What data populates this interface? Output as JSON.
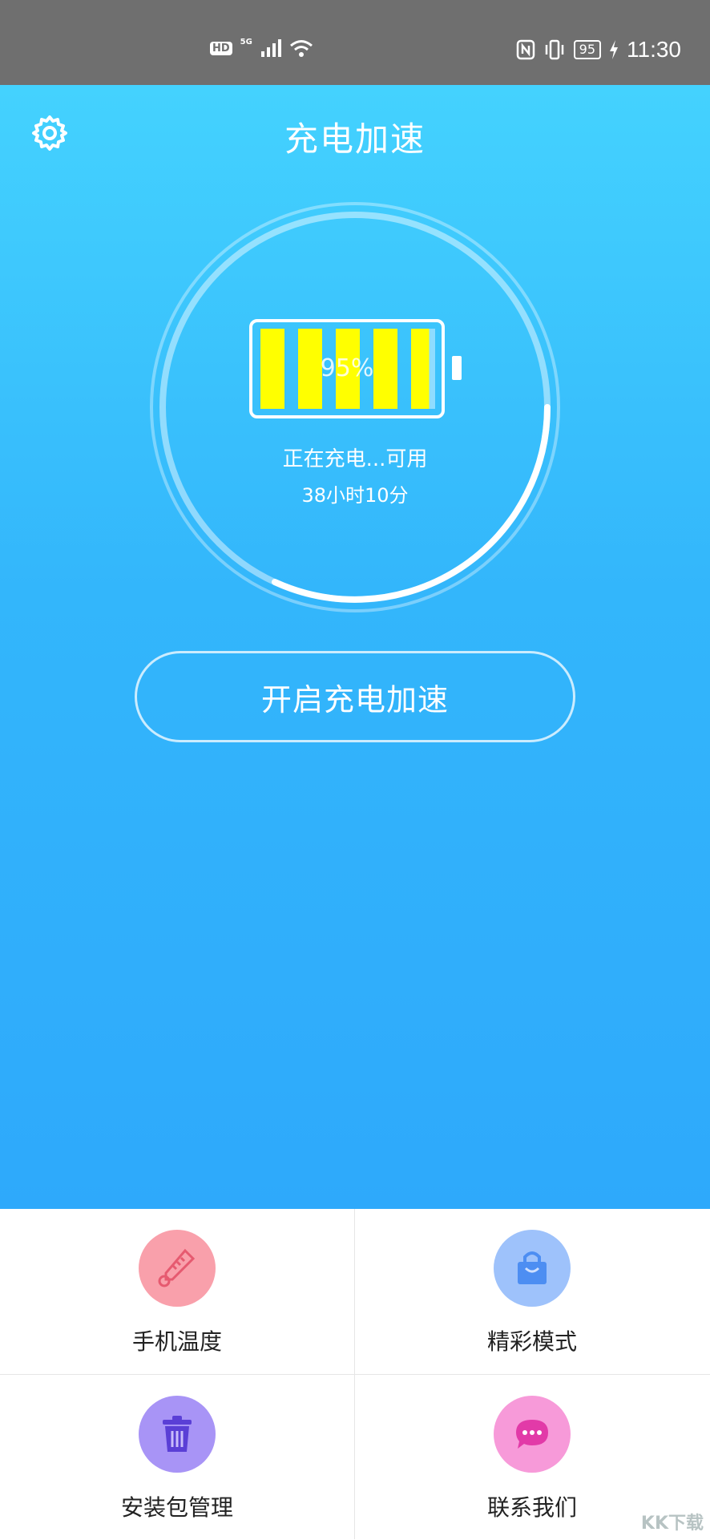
{
  "status_bar": {
    "hd": "HD",
    "network": "5G",
    "battery": "95",
    "time": "11:30"
  },
  "header": {
    "title": "充电加速",
    "settings_icon": "gear-icon"
  },
  "battery": {
    "percent_label": "95%",
    "level": 0.95,
    "status_text": "正在充电...可用",
    "remaining_text": "38小时10分",
    "colors": {
      "filled": "#ffff00",
      "empty": "#8fdcff"
    }
  },
  "boost_button": {
    "label": "开启充电加速"
  },
  "tiles": [
    {
      "label": "手机温度",
      "icon": "thermometer-icon",
      "color": "#f9a0ab"
    },
    {
      "label": "精彩模式",
      "icon": "shopping-bag-icon",
      "color": "#9ec2fb"
    },
    {
      "label": "安装包管理",
      "icon": "trash-icon",
      "color": "#a894f6"
    },
    {
      "label": "联系我们",
      "icon": "chat-bubble-icon",
      "color": "#f79ad9"
    }
  ],
  "watermark": "KK下载"
}
